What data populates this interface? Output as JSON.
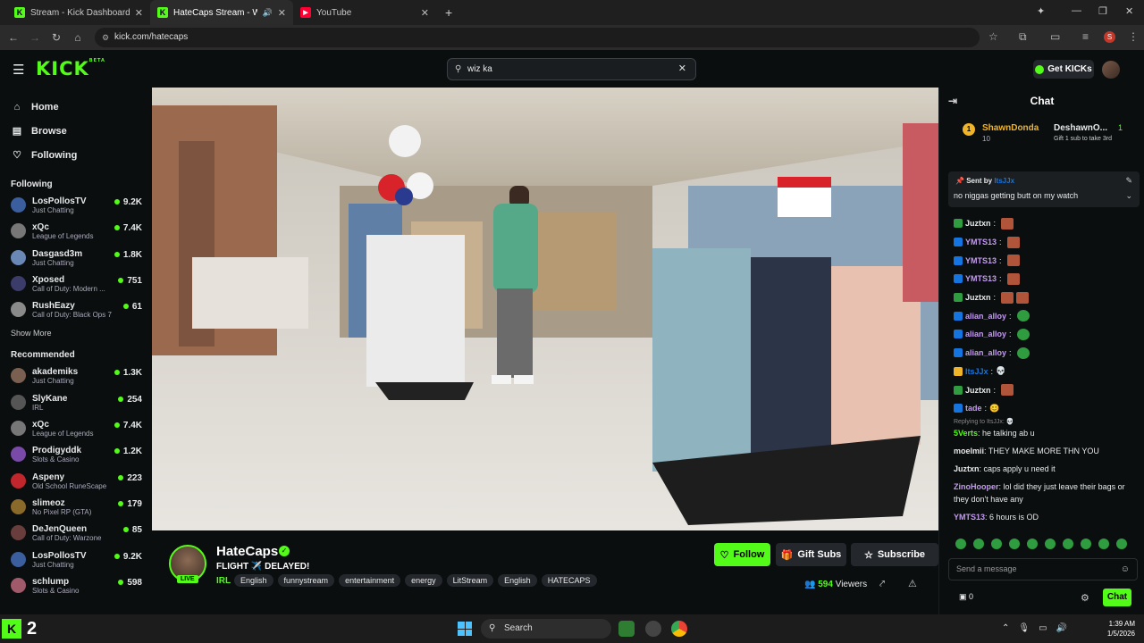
{
  "browser": {
    "tabs": [
      {
        "title": "Stream - Kick Dashboard",
        "icon": "kick-favicon",
        "active": false
      },
      {
        "title": "HateCaps Stream - Watch L",
        "icon": "kick-favicon",
        "active": true
      },
      {
        "title": "YouTube",
        "icon": "youtube-favicon",
        "active": false
      }
    ],
    "url": "kick.com/hatecaps",
    "profile_initial": "S"
  },
  "header": {
    "logo": "KICK",
    "logo_beta": "BETA",
    "search_value": "wiz ka",
    "get_kicks": "Get KICKs"
  },
  "sidebar": {
    "nav": [
      {
        "label": "Home",
        "icon": "home-icon"
      },
      {
        "label": "Browse",
        "icon": "browse-icon"
      },
      {
        "label": "Following",
        "icon": "heart-icon"
      }
    ],
    "following_title": "Following",
    "following": [
      {
        "name": "LosPollosTV",
        "category": "Just Chatting",
        "viewers": "9.2K",
        "color": "#3b5f9e"
      },
      {
        "name": "xQc",
        "category": "League of Legends",
        "viewers": "7.4K",
        "color": "#777"
      },
      {
        "name": "Dasgasd3m",
        "category": "Just Chatting",
        "viewers": "1.8K",
        "color": "#6a88b5"
      },
      {
        "name": "Xposed",
        "category": "Call of Duty: Modern ...",
        "viewers": "751",
        "color": "#3c3c6a"
      },
      {
        "name": "RushEazy",
        "category": "Call of Duty: Black Ops 7",
        "viewers": "61",
        "color": "#8a8a8a"
      }
    ],
    "show_more": "Show More",
    "recommended_title": "Recommended",
    "recommended": [
      {
        "name": "akademiks",
        "category": "Just Chatting",
        "viewers": "1.3K",
        "color": "#7a6050"
      },
      {
        "name": "SlyKane",
        "category": "IRL",
        "viewers": "254",
        "color": "#555"
      },
      {
        "name": "xQc",
        "category": "League of Legends",
        "viewers": "7.4K",
        "color": "#777"
      },
      {
        "name": "Prodigyddk",
        "category": "Slots & Casino",
        "viewers": "1.2K",
        "color": "#7a4aa8"
      },
      {
        "name": "Aspeny",
        "category": "Old School RuneScape",
        "viewers": "223",
        "color": "#c0262b"
      },
      {
        "name": "slimeoz",
        "category": "No Pixel RP (GTA)",
        "viewers": "179",
        "color": "#8a6a2a"
      },
      {
        "name": "DeJenQueen",
        "category": "Call of Duty: Warzone",
        "viewers": "85",
        "color": "#6a3d3d"
      },
      {
        "name": "LosPollosTV",
        "category": "Just Chatting",
        "viewers": "9.2K",
        "color": "#3b5f9e"
      },
      {
        "name": "schlump",
        "category": "Slots & Casino",
        "viewers": "598",
        "color": "#a05a6a"
      }
    ]
  },
  "stream": {
    "streamer": "HateCaps",
    "live": "LIVE",
    "title": "FLIGHT ✈️ DELAYED!",
    "category": "IRL",
    "tags": [
      "English",
      "funnystream",
      "entertainment",
      "energy",
      "LitStream",
      "English",
      "HATECAPS"
    ],
    "follow": "Follow",
    "gift_subs": "Gift Subs",
    "subscribe": "Subscribe",
    "viewers_count": "594",
    "viewers_label": "Viewers"
  },
  "chat": {
    "title": "Chat",
    "leaderboard": {
      "rank": "1",
      "first_name": "ShawnDonda",
      "first_count": "10",
      "second_name": "DeshawnO...",
      "second_count": "1",
      "gift_text": "Gift 1 sub to take 3rd"
    },
    "pinned": {
      "sent_by": "Sent by",
      "user": "ItsJJx",
      "message": "no niggas getting butt on my watch"
    },
    "messages": [
      {
        "user": "Juztxn",
        "text": "",
        "color": "#e7e9ea",
        "emotes": 1,
        "badge": "#2e9c3f"
      },
      {
        "user": "YMTS13",
        "text": "",
        "color": "#c49cf0",
        "emotes": 1,
        "badge": "#1475e1"
      },
      {
        "user": "YMTS13",
        "text": "",
        "color": "#c49cf0",
        "emotes": 1,
        "badge": "#1475e1"
      },
      {
        "user": "YMTS13",
        "text": "",
        "color": "#c49cf0",
        "emotes": 1,
        "badge": "#1475e1"
      },
      {
        "user": "Juztxn",
        "text": "",
        "color": "#e7e9ea",
        "emotes": 2,
        "badge": "#2e9c3f"
      },
      {
        "user": "alian_alloy",
        "text": "",
        "color": "#c49cf0",
        "emotes": 1,
        "badge": "#1475e1"
      },
      {
        "user": "alian_alloy",
        "text": "",
        "color": "#c49cf0",
        "emotes": 1,
        "badge": "#1475e1"
      },
      {
        "user": "alian_alloy",
        "text": "",
        "color": "#c49cf0",
        "emotes": 1,
        "badge": "#1475e1"
      },
      {
        "user": "ItsJJx",
        "text": "💀",
        "color": "#1475e1",
        "emotes": 0,
        "badge": "#f0b429"
      },
      {
        "user": "Juztxn",
        "text": "",
        "color": "#e7e9ea",
        "emotes": 1,
        "badge": "#2e9c3f"
      },
      {
        "user": "tade",
        "text": "😊",
        "color": "#c49cf0",
        "emotes": 0,
        "badge": "#1475e1"
      }
    ],
    "reply_note": "Replying to ItsJJx: 💀",
    "messages2": [
      {
        "user": "5Verts",
        "text": "he talking ab u",
        "color": "#53fc18"
      },
      {
        "user": "moelmii",
        "text": "THEY MAKE MORE THN YOU",
        "color": "#e7e9ea"
      },
      {
        "user": "Juztxn",
        "text": "caps apply u need it",
        "color": "#e7e9ea"
      },
      {
        "user": "ZinoHooper",
        "text": "lol did they just leave their bags or they don't have any",
        "color": "#c49cf0"
      },
      {
        "user": "YMTS13",
        "text": "6 hours is OD",
        "color": "#c49cf0"
      }
    ],
    "input_placeholder": "Send a message",
    "points": "0",
    "chat_button": "Chat"
  },
  "taskbar": {
    "kick_count": "2",
    "search_placeholder": "Search",
    "time": "1:39 AM",
    "date": "1/5/2026"
  },
  "colors": {
    "accent": "#53fc18",
    "bg": "#0b0e0f"
  }
}
